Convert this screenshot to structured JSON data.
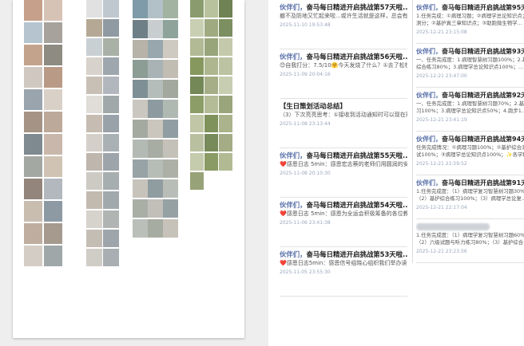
{
  "colors": {
    "sender": "#5870a8",
    "heart": "#d9302c",
    "timestamp": "#9aa6bd",
    "page_bg": "#eeeeee",
    "paper": "#ffffff"
  },
  "collage": {
    "col_a_thumbs": [
      "#c6a08a",
      "#d7c3b5",
      "#b6c4cf",
      "#a7a39c",
      "#c4a38c",
      "#8d8b82",
      "#cfc7c0",
      "#b99a86",
      "#9aa4ad",
      "#d9d1c8",
      "#a59385",
      "#bda999",
      "#7f8a90",
      "#c8b7aa",
      "#a4a8a2",
      "#d1c3b3",
      "#93857b",
      "#b2b8be",
      "#c9bdb0",
      "#8e9aa3",
      "#bfae9f",
      "#a69a8f",
      "#d4cdc5",
      "#9fa7a8"
    ],
    "col_b_thumbs": [
      "#e1e1e1",
      "#c0c8cf",
      "#b5a995",
      "#8f9aa2",
      "#c9d0d4",
      "#a9b0a6",
      "#d7d2cb",
      "#9ea6ae",
      "#c8c0b5",
      "#b1b7bd",
      "#e0ddd8",
      "#a0a8a9",
      "#c6bcb2",
      "#99a1a9",
      "#d4d0c9",
      "#aab1b4",
      "#bfb6ad",
      "#9da4aa",
      "#cdcac4",
      "#a6aeb0",
      "#c2baaf",
      "#a2a9ad",
      "#d6d2cc",
      "#b0b4b3",
      "#c4bdb4",
      "#9fa6ab",
      "#d0ccc6",
      "#a8aeb1"
    ],
    "col_c_thumbs": [
      "#7f9aa8",
      "#b2c0c7",
      "#a3b3a2",
      "#6e7f87",
      "#c8cdd0",
      "#8ea39a",
      "#b7b3a8",
      "#97a7ad",
      "#cfcac1",
      "#8b9d94",
      "#a9b3b5",
      "#c1bdb3",
      "#7e8f96",
      "#b4bdb9",
      "#a2a89d",
      "#c9c7c0",
      "#8d9ba1",
      "#b0b8b2",
      "#a5aaa0",
      "#cbc6bd",
      "#909ea3",
      "#b3bab4",
      "#a8ada4",
      "#c4c1b9",
      "#98a3a6",
      "#b6bcb6",
      "#acb0a7",
      "#c7c3bb",
      "#8f9ca0",
      "#b9bdb7",
      "#aaafa6",
      "#c2bfb8",
      "#96a1a4",
      "#bbbfb9",
      "#a7aca3",
      "#c6c2ba"
    ],
    "col_d_thumbs": [
      "#8a9c6e",
      "#b8c29c",
      "#6f8253",
      "#c9cfb2",
      "#a0aa81",
      "#7c8f60",
      "#b1ba95",
      "#98a47a",
      "#c3c9aa",
      "#87985f",
      "#adb68f",
      "#bcc3a2",
      "#748757",
      "#a5ae86",
      "#c7cdb0",
      "#8d9d67",
      "#b4bc97",
      "#9aa57c",
      "#c0c6a6",
      "#80925b",
      "#aab38b",
      "#b9c09f",
      "#778a59",
      "#a3ac84",
      "#c5cbad",
      "#8b9b65",
      "#b2ba94",
      "#97a278"
    ]
  },
  "feed_left": [
    {
      "sender": "伙伴们，",
      "title_rest": "奋马每日精进开启挑战第57天啦...",
      "body": "撤不及防地又忙起来啦...或许生活就是这样，总会有意料之外的事情发生，也正因如此，人生才充满...",
      "time": "2025-11-10 19:53:48"
    },
    {
      "sender": "伙伴们，",
      "title_rest": "奋马每日精进开启挑战第56天啦...",
      "body": "😊自我打分：7.5/10🤗今天发烧了什么？①去了松校本部时频医院；②进行文章阅读与感悟输出；...",
      "time": "2025-11-09 20:04:16"
    },
    {
      "sender": "",
      "title_rest": "【生日策划活动总结】",
      "body": "（3）下次亮亮思考：①接收到活动通知时可以现在班群和班委群里发些小小的预告，提前告知界各...",
      "time": "2025-11-08 23:13:44"
    },
    {
      "sender": "伙伴们，",
      "title_rest": "奋马每日精进开启挑战第55天啦...",
      "body": "❤️感恩日志 5min：感恩宏志蔡的老师们用圆润的安排与耐心的服务保障；感恩信号组、钱青姐尽心尽...",
      "time": "2025-11-08 20:10:30"
    },
    {
      "sender": "伙伴们，",
      "title_rest": "奋马每日精进开启挑战第54天啦...",
      "body": "❤️感恩日志 5min：感恩为全运会积极筹备的各位教师以及志愿者们。感恩身边与我并肩作战的伙伴...",
      "time": "2025-11-06 23:41:38"
    },
    {
      "sender": "伙伴们，",
      "title_rest": "奋马每日精进开启挑战第53天啦...",
      "body": "❤️感恩日志5min：感恩信号组晓心组织我们举办读书分享会，感恩信号组诚实在的分享与耐心的答...",
      "time": "2025-11-05 23:55:30"
    }
  ],
  "feed_right": [
    {
      "sender": "伙伴们，",
      "title_rest": "奋马每日精进开启挑战第95天啦...",
      "body1": "1.任务完成：①病理习题；②病理学总论知识点；③病理学总论知识点",
      "body2": "测分；②基护真三章知识点；③助跑微生物学...",
      "time": "2025-12-21 23:15:08"
    },
    {
      "sender": "伙伴们，",
      "title_rest": "奋马每日精进开启挑战第93天啦...",
      "body1": "一、任务完成度：1.病理智慧树习题100%；2.基护",
      "body2": "综合练习80%；3.病理学总论知识点100%；...",
      "time": "2025-12-21 23:47:00"
    },
    {
      "sender": "伙伴们，",
      "title_rest": "奋马每日精进开启挑战第92天啦...",
      "body1": "一、任务完成度：1.病理智慧树习题70%；2.基护练",
      "body2": "习100%；3.病理学总论知识点50%；4.跑步1...",
      "time": "2025-12-21 23:41:19"
    },
    {
      "sender": "伙伴们，",
      "title_rest": "奋马每日精进开启挑战第94天啦...",
      "body1": "任务完成情况：①病理习题100%；②基护综合测",
      "body2": "试100%；③病理学总论知识点100%；✨各学科...",
      "time": "2025-12-21 22:59:52"
    },
    {
      "sender": "伙伴们，",
      "title_rest": "奋马每日精进开启挑战第91天啦...",
      "body1": "1.任务完成度：（1）病理学复习智慧树习题30%；",
      "body2": "（2）基护综合练习100%；（3）病理学总论复...",
      "time": "2025-12-21 22:17:04"
    },
    {
      "sender": "",
      "title_rest": "",
      "body1": "1.任务完成度：（1）病理学复习智慧树习题60%；",
      "body2": "（2）六级试题与听力练习80%；（3）基护综合...",
      "time": "2025-12-21 23:23:56"
    }
  ]
}
